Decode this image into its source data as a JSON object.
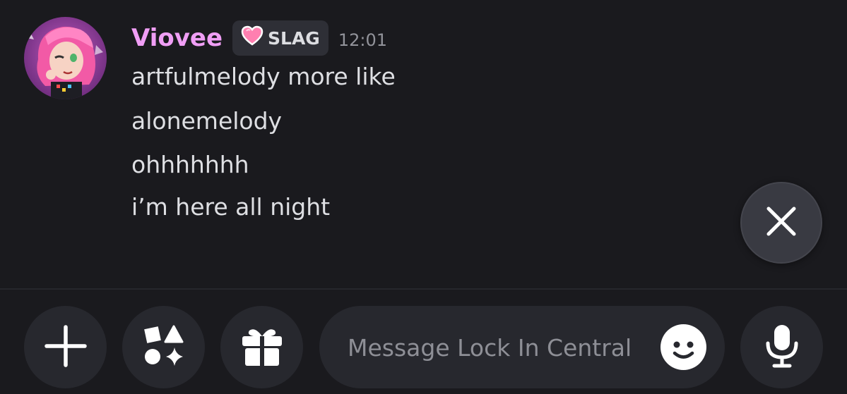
{
  "message": {
    "username": "Viovee",
    "tag": "SLAG",
    "timestamp": "12:01",
    "lines": [
      "artfulmelody more like",
      "alonemelody",
      "ohhhhhhh",
      "i’m here all night"
    ]
  },
  "composer": {
    "placeholder": "Message Lock In Central"
  },
  "colors": {
    "background": "#1a1a1e",
    "username": "#f09ef5",
    "button_bg": "#27282e"
  },
  "icons": {
    "tag_icon": "pink-heart-icon",
    "close": "close-icon",
    "add": "plus-icon",
    "apps": "apps-icon",
    "gift": "gift-icon",
    "emoji": "smile-icon",
    "voice": "microphone-icon"
  }
}
